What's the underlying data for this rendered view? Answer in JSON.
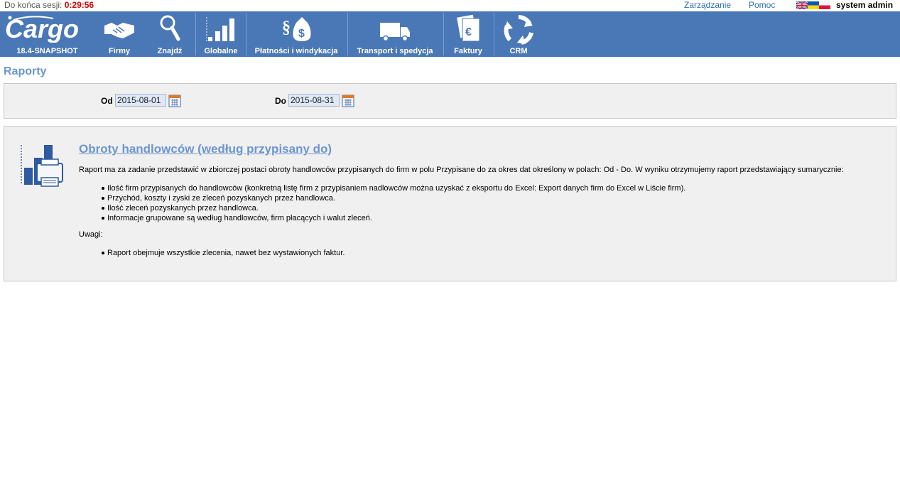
{
  "session": {
    "label": "Do końca sesji:",
    "timer": "0:29:56"
  },
  "toplinks": {
    "manage": "Zarządzanie",
    "help": "Pomoc",
    "user": "system admin"
  },
  "nav": {
    "version": "18.4-SNAPSHOT",
    "items": [
      "Firmy",
      "Znajdź",
      "Globalne",
      "Płatności i windykacja",
      "Transport i spedycja",
      "Faktury",
      "CRM"
    ]
  },
  "page": {
    "title": "Raporty"
  },
  "dates": {
    "from_label": "Od",
    "from_value": "2015-08-01",
    "to_label": "Do",
    "to_value": "2015-08-31"
  },
  "report": {
    "title": "Obroty handlowców (według przypisany do)",
    "description": "Raport ma za zadanie przedstawić w zbiorczej postaci obroty handlowców przypisanych do firm w polu Przypisane do za okres dat określony w polach: Od - Do. W wyniku otrzymujemy raport przedstawiający sumarycznie:",
    "bullets": [
      "Ilość firm przypisanych do handlowców (konkretną listę firm z przypisaniem nadlowców można uzyskać z eksportu do Excel: Export danych firm do Excel w Liście firm).",
      "Przychód, koszty i zyski ze zleceń pozyskanych przez handlowca.",
      "Ilość zleceń pozyskanych przez handlowca.",
      "Informacje grupowane są według handlowców, firm płacących i walut zleceń."
    ],
    "notes_label": "Uwagi:",
    "notes": [
      "Raport obejmuje wszystkie zlecenia, nawet bez wystawionych faktur."
    ]
  },
  "colors": {
    "navbar": "#4a78b6",
    "accent": "#6d95d2",
    "timer": "#d40000",
    "link": "#2a6db0"
  }
}
